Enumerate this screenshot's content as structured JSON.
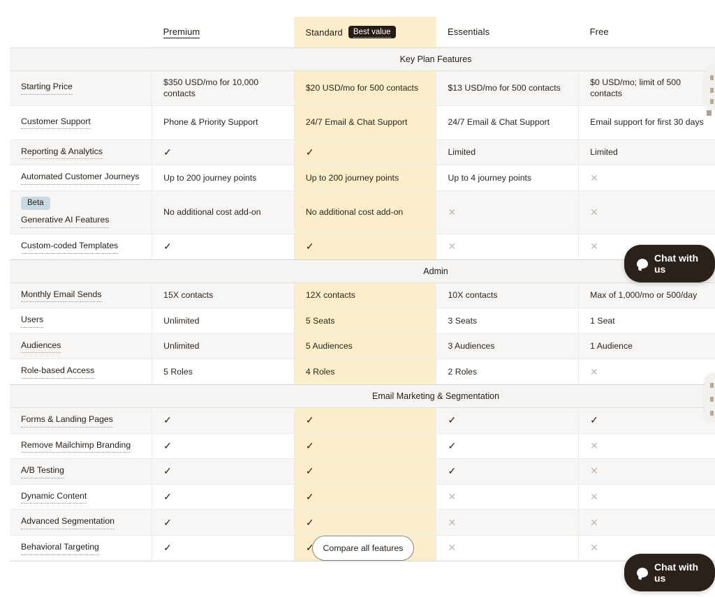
{
  "table": {
    "feature_column_header": "",
    "plans": [
      {
        "name": "Premium",
        "badge": null,
        "highlight": false
      },
      {
        "name": "Standard",
        "badge": "Best value",
        "highlight": true
      },
      {
        "name": "Essentials",
        "badge": null,
        "highlight": false
      },
      {
        "name": "Free",
        "badge": null,
        "highlight": false
      }
    ],
    "sections": [
      {
        "title": "Key Plan Features",
        "rows": [
          {
            "feature": "Starting Price",
            "badge": null,
            "values": [
              "$350 USD/mo for 10,000 contacts",
              "$20 USD/mo for 500 contacts",
              "$13 USD/mo for 500 contacts",
              "$0 USD/mo; limit of 500 contacts"
            ]
          },
          {
            "feature": "Customer Support",
            "badge": null,
            "values": [
              "Phone & Priority Support",
              "24/7 Email & Chat Support",
              "24/7 Email & Chat Support",
              "Email support for first 30 days"
            ]
          },
          {
            "feature": "Reporting & Analytics",
            "badge": null,
            "values": [
              "yes",
              "yes",
              "Limited",
              "Limited"
            ]
          },
          {
            "feature": "Automated Customer Journeys",
            "badge": null,
            "values": [
              "Up to 200 journey points",
              "Up to 200 journey points",
              "Up to 4 journey points",
              "no"
            ]
          },
          {
            "feature": "Generative AI Features",
            "badge": "Beta",
            "values": [
              "No additional cost add-on",
              "No additional cost add-on",
              "no",
              "no"
            ]
          },
          {
            "feature": "Custom-coded Templates",
            "badge": null,
            "values": [
              "yes",
              "yes",
              "no",
              "no"
            ]
          }
        ]
      },
      {
        "title": "Admin",
        "rows": [
          {
            "feature": "Monthly Email Sends",
            "badge": null,
            "values": [
              "15X contacts",
              "12X contacts",
              "10X contacts",
              "Max of 1,000/mo or 500/day"
            ]
          },
          {
            "feature": "Users",
            "badge": null,
            "values": [
              "Unlimited",
              "5 Seats",
              "3 Seats",
              "1 Seat"
            ]
          },
          {
            "feature": "Audiences",
            "badge": null,
            "values": [
              "Unlimited",
              "5 Audiences",
              "3 Audiences",
              "1 Audience"
            ]
          },
          {
            "feature": "Role-based Access",
            "badge": null,
            "values": [
              "5 Roles",
              "4 Roles",
              "2 Roles",
              "no"
            ]
          }
        ]
      },
      {
        "title": "Email Marketing & Segmentation",
        "rows": [
          {
            "feature": "Forms & Landing Pages",
            "badge": null,
            "values": [
              "yes",
              "yes",
              "yes",
              "yes"
            ]
          },
          {
            "feature": "Remove Mailchimp Branding",
            "badge": null,
            "values": [
              "yes",
              "yes",
              "yes",
              "no"
            ]
          },
          {
            "feature": "A/B Testing",
            "badge": null,
            "values": [
              "yes",
              "yes",
              "yes",
              "no"
            ]
          },
          {
            "feature": "Dynamic Content",
            "badge": null,
            "values": [
              "yes",
              "yes",
              "no",
              "no"
            ]
          },
          {
            "feature": "Advanced Segmentation",
            "badge": null,
            "values": [
              "yes",
              "yes",
              "no",
              "no"
            ]
          },
          {
            "feature": "Behavioral Targeting",
            "badge": null,
            "values": [
              "yes",
              "yes",
              "no",
              "no"
            ]
          }
        ]
      }
    ]
  },
  "compare_button": {
    "label": "Compare all features"
  },
  "chat_widget": {
    "label": "Chat with us",
    "icon": "chat-bubble-icon"
  },
  "glyphs": {
    "yes": "✓",
    "no": "✕"
  },
  "colors": {
    "highlight": "#fbeecb",
    "section_band": "#f5f4f2",
    "row_shade": "#f7f6f4",
    "text": "#241c15",
    "muted_mark": "#bdb8b2",
    "badge_dark": "#241c15",
    "beta_badge": "#c9dae5",
    "chat_bg": "#2b211b"
  }
}
